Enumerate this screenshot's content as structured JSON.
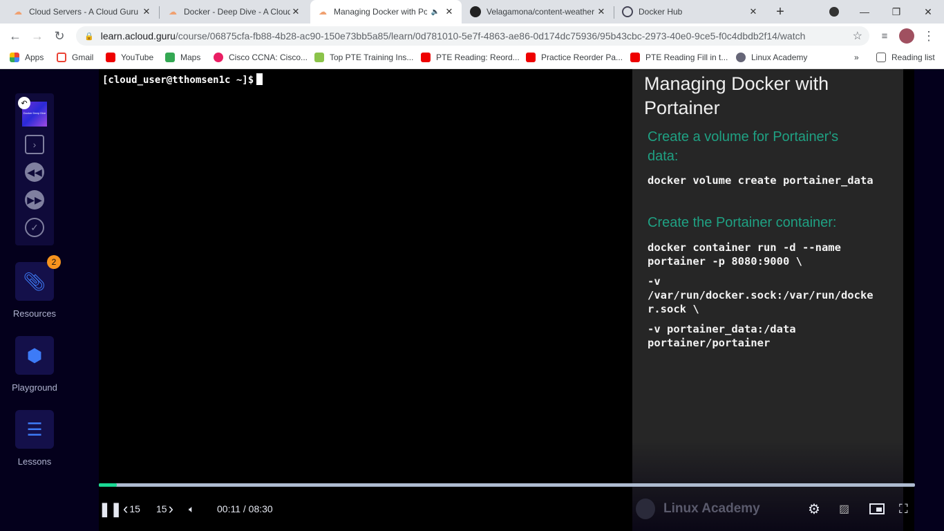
{
  "browser": {
    "tabs": [
      {
        "title": "Cloud Servers - A Cloud Guru",
        "icon": "acg-cloud-icon"
      },
      {
        "title": "Docker - Deep Dive - A Cloud Guru",
        "icon": "acg-cloud-icon"
      },
      {
        "title": "Managing Docker with Portainer",
        "icon": "acg-cloud-icon",
        "active": true,
        "audio": "speaker-icon"
      },
      {
        "title": "Velagamona/content-weather",
        "icon": "github-icon"
      },
      {
        "title": "Docker Hub",
        "icon": "docker-icon"
      }
    ],
    "url_host": "learn.acloud.guru",
    "url_path": "/course/06875cfa-fb88-4b28-ac90-150e73bb5a85/learn/0d781010-5e7f-4863-ae86-0d174dc75936/95b43cbc-2973-40e0-9ce5-f0c4dbdb2f14/watch",
    "bookmarks": [
      "Apps",
      "Gmail",
      "YouTube",
      "Maps",
      "Cisco CCNA: Cisco...",
      "Top PTE Training Ins...",
      "PTE Reading: Reord...",
      "Practice Reorder Pa...",
      "PTE Reading Fill in t...",
      "Linux Academy"
    ],
    "more": "»",
    "reading_list": "Reading list"
  },
  "sidebar": {
    "thumbnail_text": "Docker Deep Dive",
    "resources_label": "Resources",
    "resources_badge": "2",
    "playground_label": "Playground",
    "lessons_label": "Lessons"
  },
  "terminal": {
    "prompt": "[cloud_user@tthomsen1c ~]$"
  },
  "slide": {
    "title": "Managing Docker with Portainer",
    "h1": "Create a volume for Portainer's data:",
    "code1": "docker volume create portainer_data",
    "h2": "Create the Portainer container:",
    "code2": "docker container run -d --name\nportainer -p 8080:9000 \\",
    "code3": "-v\n/var/run/docker.sock:/var/run/docke\nr.sock \\",
    "code4": "-v portainer_data:/data\nportainer/portainer",
    "watermark": "Linux Academy"
  },
  "player": {
    "back_seconds": "15",
    "forward_seconds": "15",
    "time": "00:11 / 08:30",
    "progress_percent": 2.2
  },
  "colors": {
    "accent": "#1ad993",
    "slide_heading": "#1fa183",
    "badge": "#f7931e"
  }
}
